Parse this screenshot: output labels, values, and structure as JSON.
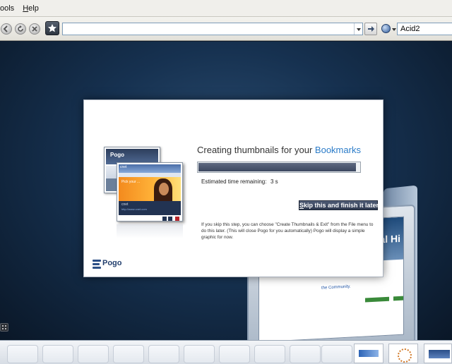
{
  "menu": {
    "tools_label": "ools",
    "help_u": "H",
    "help_rest": "elp"
  },
  "nav": {
    "url_value": "",
    "search_value": "Acid2"
  },
  "background_tile": {
    "heading_fragment": "ual Hi",
    "link_text": "the Community."
  },
  "dialog": {
    "title_prefix": "Creating thumbnails for your ",
    "title_accent": "Bookmarks",
    "progress_fraction": 0.986,
    "eta_label": "Estimated time remaining:",
    "eta_value": "3 s",
    "skip_u": "S",
    "skip_rest": "kip this and finish it later",
    "info_text": "If you skip this step, you can choose \"Create Thumbnails & Exit\" from the File menu to do this later. (This will close Pogo for you automatically) Pogo will display a simple graphic for now.",
    "logo_text": "Pogo",
    "thumb1_logo": "Pogo",
    "thumb2_header": "cnet",
    "thumb2_hero": "Pick your ...",
    "thumb2_footer": "cnet",
    "thumb2_url": "http://www.cnet.com"
  },
  "colors": {
    "accent": "#2a7bc8",
    "skip_button": "#3b475e",
    "progress_fill": "#4a5570"
  }
}
